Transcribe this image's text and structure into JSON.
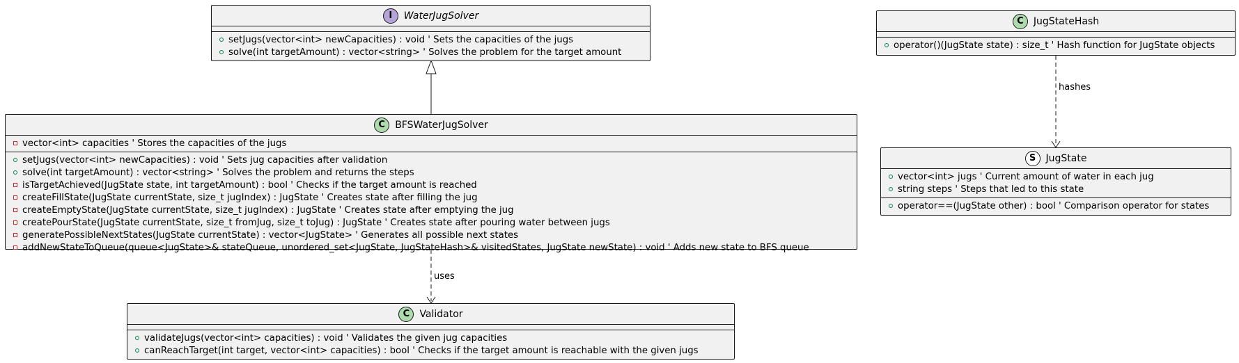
{
  "classes": {
    "water_jug_solver": {
      "stereotype": "I",
      "name": "WaterJugSolver",
      "methods": [
        {
          "visibility": "public",
          "text": "setJugs(vector<int> newCapacities) : void  ' Sets the capacities of the jugs"
        },
        {
          "visibility": "public",
          "text": "solve(int targetAmount) : vector<string>   ' Solves the problem for the target amount"
        }
      ]
    },
    "bfs_water_jug_solver": {
      "stereotype": "C",
      "name": "BFSWaterJugSolver",
      "fields": [
        {
          "visibility": "private",
          "text": "vector<int> capacities  ' Stores the capacities of the jugs"
        }
      ],
      "methods": [
        {
          "visibility": "public",
          "text": "setJugs(vector<int> newCapacities) : void  ' Sets jug capacities after validation"
        },
        {
          "visibility": "public",
          "text": "solve(int targetAmount) : vector<string>   ' Solves the problem and returns the steps"
        },
        {
          "visibility": "private",
          "text": "isTargetAchieved(JugState state, int targetAmount) : bool  ' Checks if the target amount is reached"
        },
        {
          "visibility": "private",
          "text": "createFillState(JugState currentState, size_t jugIndex) : JugState  ' Creates state after filling the jug"
        },
        {
          "visibility": "private",
          "text": "createEmptyState(JugState currentState, size_t jugIndex) : JugState  ' Creates state after emptying the jug"
        },
        {
          "visibility": "private",
          "text": "createPourState(JugState currentState, size_t fromJug, size_t toJug) : JugState  ' Creates state after pouring water between jugs"
        },
        {
          "visibility": "private",
          "text": "generatePossibleNextStates(JugState currentState) : vector<JugState>  ' Generates all possible next states"
        },
        {
          "visibility": "private",
          "text": "addNewStateToQueue(queue<JugState>& stateQueue, unordered_set<JugState, JugStateHash>& visitedStates, JugState newState) : void  ' Adds new state to BFS queue"
        }
      ]
    },
    "validator": {
      "stereotype": "C",
      "name": "Validator",
      "methods": [
        {
          "visibility": "public",
          "text": "validateJugs(vector<int> capacities) : void  ' Validates the given jug capacities"
        },
        {
          "visibility": "public",
          "text": "canReachTarget(int target, vector<int> capacities) : bool  ' Checks if the target amount is reachable with the given jugs"
        }
      ]
    },
    "jug_state_hash": {
      "stereotype": "C",
      "name": "JugStateHash",
      "methods": [
        {
          "visibility": "public",
          "text": "operator()(JugState state) : size_t  ' Hash function for JugState objects"
        }
      ]
    },
    "jug_state": {
      "stereotype": "S",
      "name": "JugState",
      "fields": [
        {
          "visibility": "public",
          "text": "vector<int> jugs   ' Current amount of water in each jug"
        },
        {
          "visibility": "public",
          "text": "string steps   ' Steps that led to this state"
        }
      ],
      "methods": [
        {
          "visibility": "public",
          "text": "operator==(JugState other) : bool  ' Comparison operator for states"
        }
      ]
    }
  },
  "relations": {
    "uses_label": "uses",
    "hashes_label": "hashes"
  },
  "colors": {
    "box_fill": "#f1f1f1",
    "border": "#181818",
    "class_badge": "#addbad",
    "interface_badge": "#b5a4d8",
    "public_marker": "#038048",
    "private_marker": "#c82930"
  }
}
